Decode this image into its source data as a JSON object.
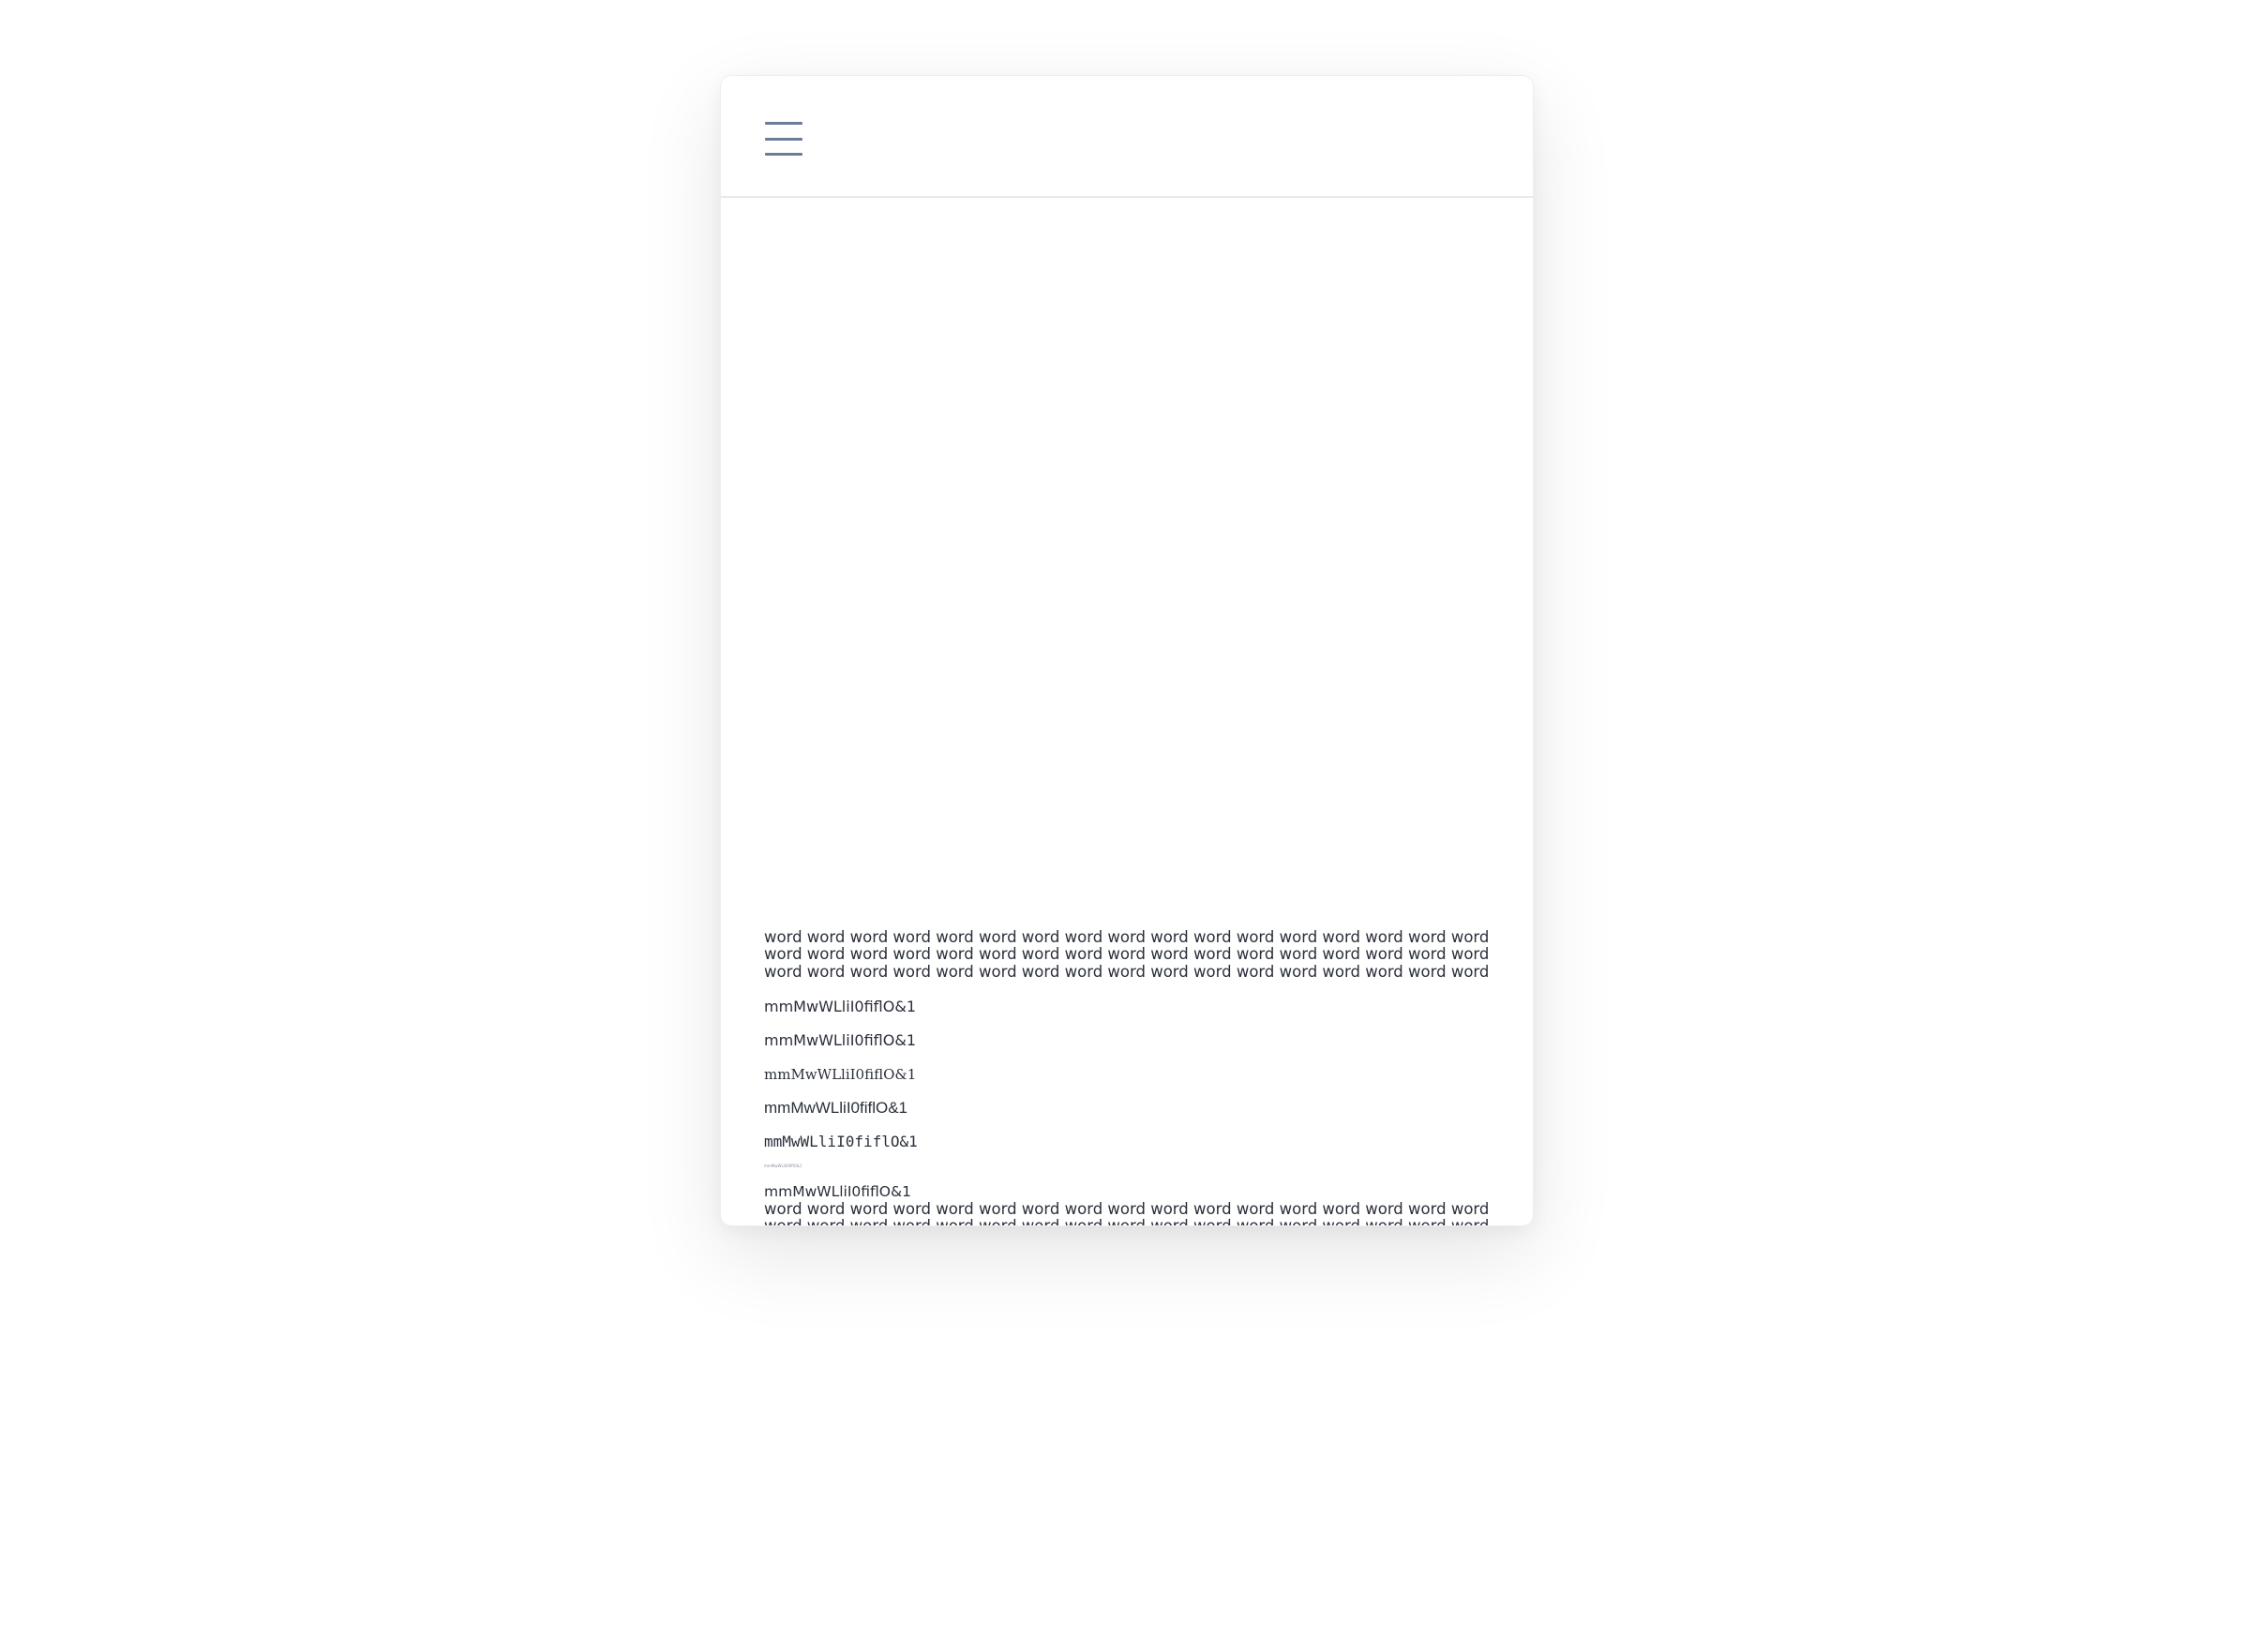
{
  "header": {
    "menu_icon": "hamburger-menu-icon"
  },
  "content": {
    "paragraph_top": "word word word word word word word word word word word word word word word word word word word word word word word word word word word word word word word word word word word word word word word word word word word word word word word word word word word",
    "specimen_1": "mmMwWLliI0fiflO&1",
    "specimen_2": "mmMwWLliI0fiflO&1",
    "specimen_3": "mmMwWLliI0fiflO&1",
    "specimen_4": "mmMwWLliI0fiflO&1",
    "specimen_5": "mmMwWLliI0fiflO&1",
    "specimen_tiny": "mmMwWLliI0fiflO&1",
    "specimen_6": "mmMwWLliI0fiflO&1",
    "paragraph_bottom": "word word word word word word word word word word word word word word word word word word word word word word word word word word word word word word word word word word word word word word word word word word word word word word word word word word"
  },
  "colors": {
    "text": "#2a2f3a",
    "menu_icon": "#6b7c99",
    "divider": "#e7e9ee"
  }
}
